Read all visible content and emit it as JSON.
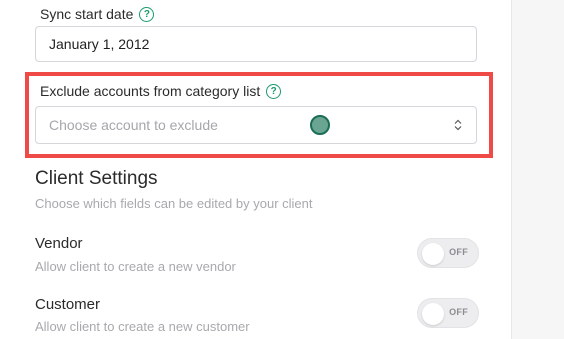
{
  "sync_start": {
    "label": "Sync start date",
    "value": "January 1, 2012",
    "help_icon": "question-circle-icon"
  },
  "exclude_accounts": {
    "label": "Exclude accounts from category list",
    "placeholder": "Choose account to exclude",
    "help_icon": "question-circle-icon",
    "caret_icon": "select-updown-icon"
  },
  "client_settings": {
    "title": "Client Settings",
    "subtitle": "Choose which fields can be edited by your client",
    "items": [
      {
        "title": "Vendor",
        "description": "Allow client to create a new vendor",
        "toggle_text": "OFF"
      },
      {
        "title": "Customer",
        "description": "Allow client to create a new customer",
        "toggle_text": "OFF"
      }
    ]
  },
  "colors": {
    "accent": "#1a9a6a",
    "highlight": "#f04a46"
  }
}
